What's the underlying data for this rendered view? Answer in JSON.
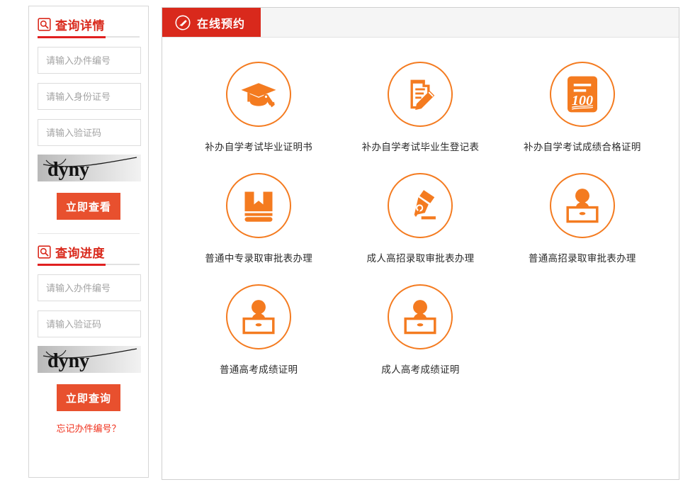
{
  "sidebar": {
    "sections": [
      {
        "icon": "search-square-icon",
        "title": "查询详情",
        "fields": [
          {
            "name": "case-number-input",
            "placeholder": "请输入办件编号"
          },
          {
            "name": "id-card-input",
            "placeholder": "请输入身份证号"
          },
          {
            "name": "captcha-input",
            "placeholder": "请输入验证码"
          }
        ],
        "captcha_text": "dyny",
        "button_label": "立即查看"
      },
      {
        "icon": "search-square-icon",
        "title": "查询进度",
        "fields": [
          {
            "name": "case-number-input",
            "placeholder": "请输入办件编号"
          },
          {
            "name": "captcha-input",
            "placeholder": "请输入验证码"
          }
        ],
        "captcha_text": "dyny",
        "button_label": "立即查询"
      }
    ],
    "forgot_link": "忘记办件编号？"
  },
  "main": {
    "tab": {
      "icon": "pencil-circle-icon",
      "label": "在线预约"
    },
    "services": [
      {
        "icon": "graduation-cap-icon",
        "label": "补办自学考试毕业证明书"
      },
      {
        "icon": "document-pencil-icon",
        "label": "补办自学考试毕业生登记表"
      },
      {
        "icon": "score-100-icon",
        "label": "补办自学考试成绩合格证明"
      },
      {
        "icon": "book-bookmark-icon",
        "label": "普通中专录取审批表办理"
      },
      {
        "icon": "pen-nib-icon",
        "label": "成人高招录取审批表办理"
      },
      {
        "icon": "person-desk-icon",
        "label": "普通高招录取审批表办理"
      },
      {
        "icon": "person-desk-icon",
        "label": "普通高考成绩证明"
      },
      {
        "icon": "person-desk-icon",
        "label": "成人高考成绩证明"
      }
    ]
  },
  "colors": {
    "brand_red": "#d9291c",
    "button_orange": "#e8502e",
    "icon_orange": "#f47b20",
    "link_red": "#f0321e"
  }
}
